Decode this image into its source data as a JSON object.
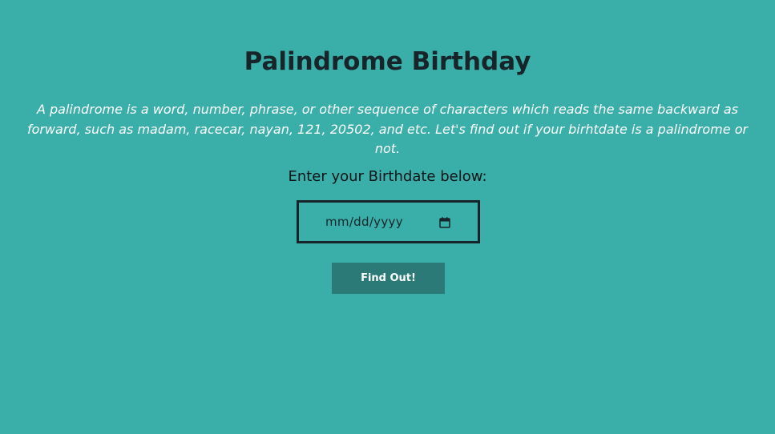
{
  "page": {
    "title": "Palindrome Birthday",
    "description": "A palindrome is a word, number, phrase, or other sequence of characters which reads the same backward as forward, such as madam, racecar, nayan, 121, 20502, and etc. Let's find out if your birhtdate is a palindrome or not."
  },
  "form": {
    "label": "Enter your Birthdate below:",
    "date_placeholder": "mm/dd/yyyy",
    "calendar_icon": "calendar-icon",
    "submit_label": "Find Out!"
  },
  "colors": {
    "background": "#3aafa9",
    "title": "#17252a",
    "description": "#feffff",
    "button_bg": "#2b7a78",
    "button_text": "#feffff",
    "input_border": "#17252a"
  }
}
